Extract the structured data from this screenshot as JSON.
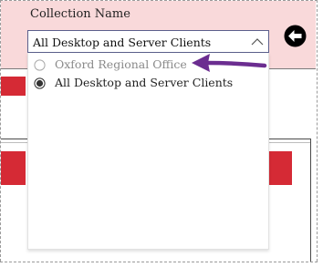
{
  "slicer": {
    "title": "Collection Name",
    "selected_value": "All Desktop and Server Clients",
    "options": [
      {
        "label": "Oxford Regional Office",
        "selected": false
      },
      {
        "label": "All Desktop and Server Clients",
        "selected": true
      }
    ]
  },
  "icons": {
    "dropdown_toggle": "chevron-up-icon",
    "back": "back-arrow-icon",
    "annotation": "annotation-arrow-icon"
  },
  "colors": {
    "panel_background": "#f9d9da",
    "accent_red": "#d52a35",
    "annotation_purple": "#6b2d90",
    "dropdown_border": "#5b5f8c"
  }
}
